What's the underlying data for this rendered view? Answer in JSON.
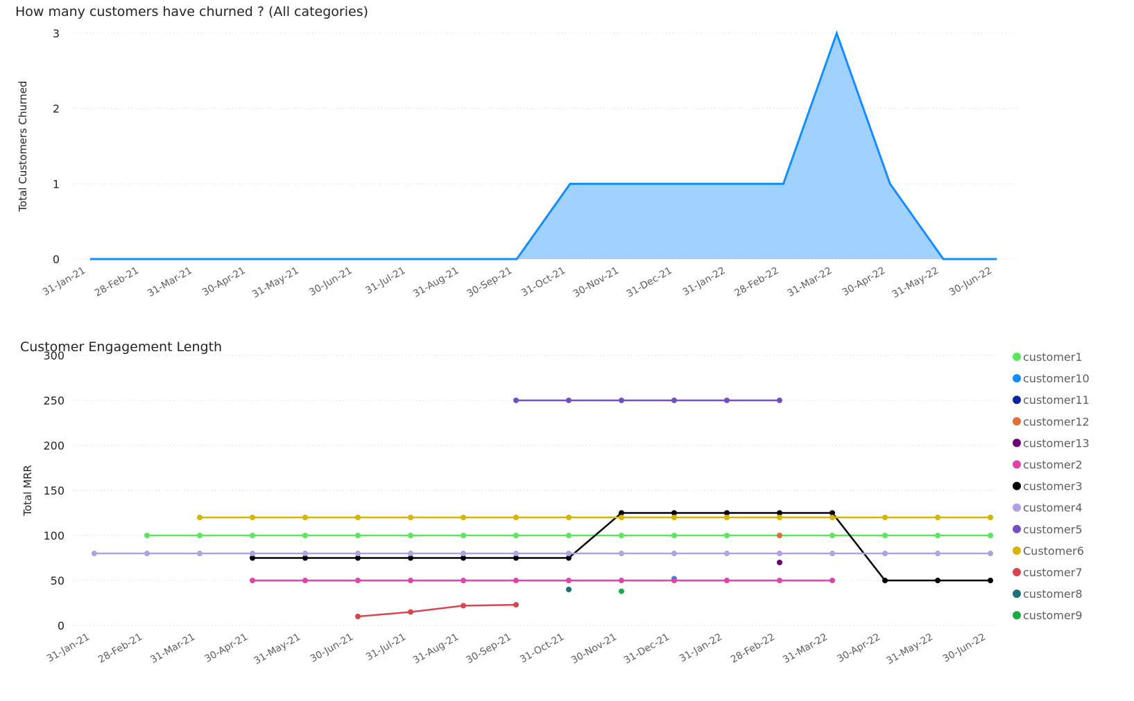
{
  "chart_data": [
    {
      "type": "area",
      "title": "How many customers have churned ? (All categories)",
      "xlabel": "",
      "ylabel": "Total Customers Churned",
      "x": [
        "31-Jan-21",
        "28-Feb-21",
        "31-Mar-21",
        "30-Apr-21",
        "31-May-21",
        "30-Jun-21",
        "31-Jul-21",
        "31-Aug-21",
        "30-Sep-21",
        "31-Oct-21",
        "30-Nov-21",
        "31-Dec-21",
        "31-Jan-22",
        "28-Feb-22",
        "31-Mar-22",
        "30-Apr-22",
        "31-May-22",
        "30-Jun-22"
      ],
      "series": [
        {
          "values": [
            0,
            0,
            0,
            0,
            0,
            0,
            0,
            0,
            0,
            1,
            1,
            1,
            1,
            1,
            3,
            1,
            0,
            0
          ]
        }
      ],
      "yticks": [
        0,
        1,
        2,
        3
      ],
      "ylim": [
        0,
        3
      ],
      "grid": true,
      "colors": {
        "line": "#118DFF",
        "fill": "#A1D1FF"
      }
    },
    {
      "type": "line",
      "title": "Customer Engagement Length",
      "xlabel": "",
      "ylabel": "Total MRR",
      "x": [
        "31-Jan-21",
        "28-Feb-21",
        "31-Mar-21",
        "30-Apr-21",
        "31-May-21",
        "30-Jun-21",
        "31-Jul-21",
        "31-Aug-21",
        "30-Sep-21",
        "31-Oct-21",
        "30-Nov-21",
        "31-Dec-21",
        "31-Jan-22",
        "28-Feb-22",
        "31-Mar-22",
        "30-Apr-22",
        "31-May-22",
        "30-Jun-22"
      ],
      "yticks": [
        0,
        50,
        100,
        150,
        200,
        250,
        300
      ],
      "ylim": [
        0,
        300
      ],
      "grid": true,
      "legend_position": "right",
      "series": [
        {
          "name": "customer1",
          "color": "#5CE65C",
          "values": [
            null,
            100,
            100,
            100,
            100,
            100,
            100,
            100,
            100,
            100,
            100,
            100,
            100,
            100,
            100,
            100,
            100,
            100
          ]
        },
        {
          "name": "customer10",
          "color": "#118DFF",
          "values": [
            null,
            null,
            null,
            null,
            null,
            null,
            null,
            null,
            null,
            null,
            null,
            52,
            null,
            null,
            null,
            null,
            null,
            null
          ]
        },
        {
          "name": "customer11",
          "color": "#12239E",
          "values": [
            null,
            null,
            null,
            null,
            null,
            null,
            null,
            null,
            null,
            null,
            null,
            null,
            null,
            null,
            null,
            null,
            null,
            null
          ]
        },
        {
          "name": "customer12",
          "color": "#E66C37",
          "values": [
            null,
            null,
            null,
            null,
            null,
            null,
            null,
            null,
            null,
            null,
            null,
            null,
            null,
            100,
            null,
            null,
            null,
            null
          ]
        },
        {
          "name": "customer13",
          "color": "#6B007B",
          "values": [
            null,
            null,
            null,
            null,
            null,
            null,
            null,
            null,
            null,
            null,
            null,
            null,
            null,
            70,
            null,
            null,
            null,
            null
          ]
        },
        {
          "name": "customer2",
          "color": "#E044A7",
          "values": [
            null,
            null,
            null,
            50,
            50,
            50,
            50,
            50,
            50,
            50,
            50,
            50,
            50,
            50,
            50,
            null,
            null,
            null
          ]
        },
        {
          "name": "customer3",
          "color": "#000000",
          "values": [
            null,
            null,
            null,
            75,
            75,
            75,
            75,
            75,
            75,
            75,
            125,
            125,
            125,
            125,
            125,
            50,
            50,
            50
          ]
        },
        {
          "name": "customer4",
          "color": "#B3A0E0",
          "values": [
            80,
            80,
            80,
            80,
            80,
            80,
            80,
            80,
            80,
            80,
            80,
            80,
            80,
            80,
            80,
            80,
            80,
            80
          ]
        },
        {
          "name": "customer5",
          "color": "#744EC2",
          "values": [
            null,
            null,
            null,
            null,
            null,
            null,
            null,
            null,
            250,
            250,
            250,
            250,
            250,
            250,
            null,
            null,
            null,
            null
          ]
        },
        {
          "name": "Customer6",
          "color": "#D9B300",
          "values": [
            null,
            null,
            120,
            120,
            120,
            120,
            120,
            120,
            120,
            120,
            120,
            120,
            120,
            120,
            120,
            120,
            120,
            120
          ]
        },
        {
          "name": "customer7",
          "color": "#D64550",
          "values": [
            null,
            null,
            null,
            null,
            null,
            10,
            15,
            22,
            23,
            null,
            null,
            null,
            null,
            null,
            null,
            null,
            null,
            null
          ]
        },
        {
          "name": "customer8",
          "color": "#197278",
          "values": [
            null,
            null,
            null,
            null,
            null,
            null,
            null,
            null,
            null,
            40,
            null,
            null,
            null,
            null,
            null,
            null,
            null,
            null
          ]
        },
        {
          "name": "customer9",
          "color": "#1AAB40",
          "values": [
            null,
            null,
            null,
            null,
            null,
            null,
            null,
            null,
            null,
            null,
            38,
            null,
            null,
            null,
            null,
            null,
            null,
            null
          ]
        }
      ]
    }
  ]
}
